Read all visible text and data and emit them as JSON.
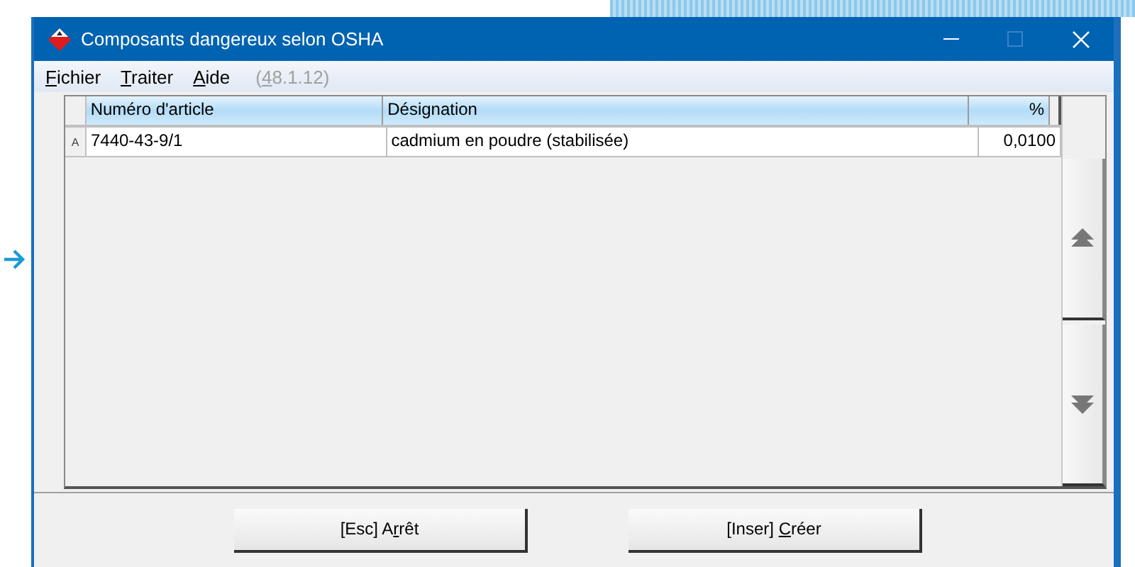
{
  "window": {
    "title": "Composants dangereux selon OSHA"
  },
  "menu": [
    {
      "key": "F",
      "rest": "ichier",
      "disabled": false
    },
    {
      "key": "T",
      "rest": "raiter",
      "disabled": false
    },
    {
      "key": "A",
      "rest": "ide",
      "disabled": false
    },
    {
      "prefix": "(",
      "key": "4",
      "rest": "8.1.12)",
      "disabled": true
    }
  ],
  "table": {
    "columns": [
      {
        "label": "Numéro d'article",
        "kind": "text"
      },
      {
        "label": "Désignation",
        "kind": "text"
      },
      {
        "label": "%",
        "kind": "number"
      }
    ],
    "rows": [
      {
        "marker": "A",
        "cells": [
          "7440-43-9/1",
          "cadmium en poudre (stabilisée)",
          "0,0100"
        ]
      }
    ]
  },
  "buttons": [
    {
      "prefix": "[Esc] A",
      "key": "r",
      "rest": "rêt"
    },
    {
      "prefix": "[Inser] ",
      "key": "C",
      "rest": "réer"
    }
  ]
}
